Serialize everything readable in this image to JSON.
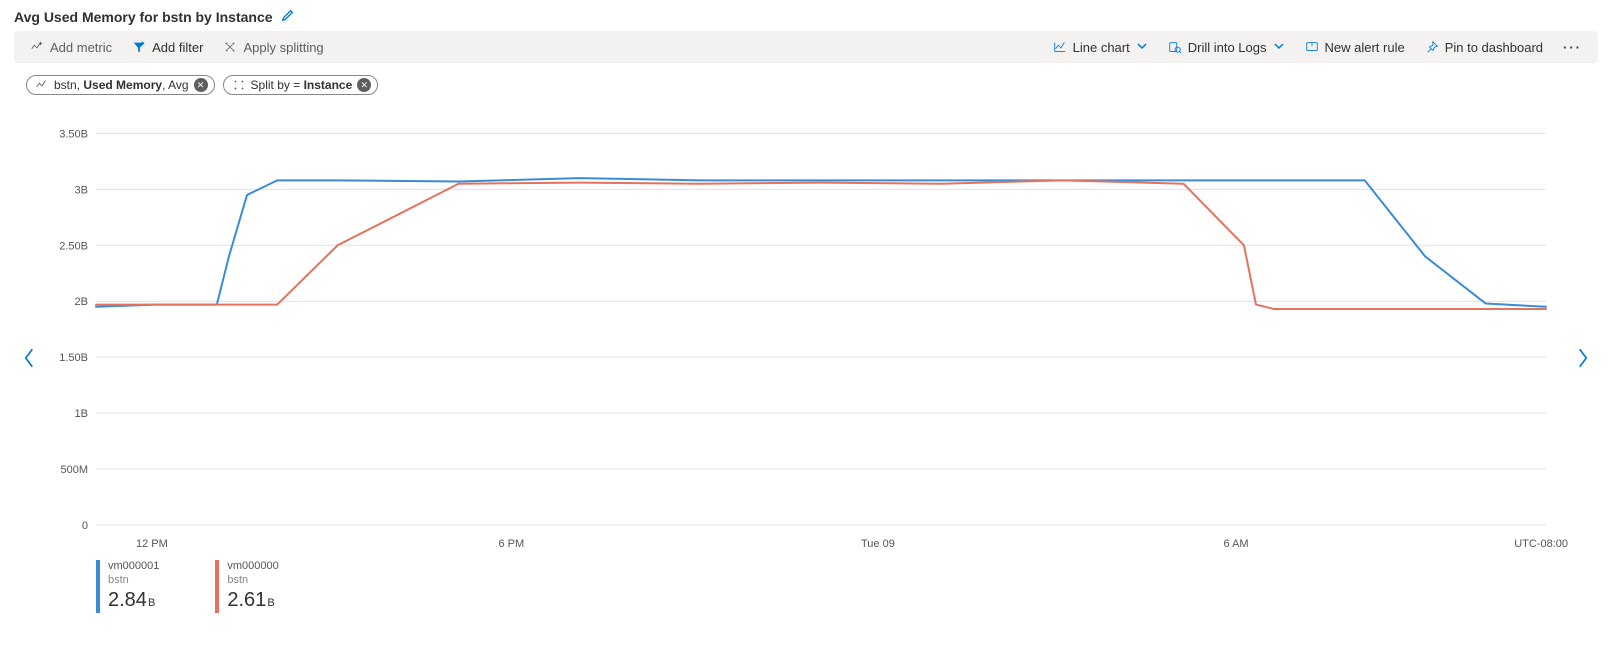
{
  "header": {
    "title": "Avg Used Memory for bstn by Instance"
  },
  "toolbar": {
    "add_metric": "Add metric",
    "add_filter": "Add filter",
    "apply_splitting": "Apply splitting",
    "line_chart": "Line chart",
    "drill_logs": "Drill into Logs",
    "new_alert": "New alert rule",
    "pin_dash": "Pin to dashboard"
  },
  "chips": {
    "metric_pre": "bstn, ",
    "metric_bold": "Used Memory",
    "metric_post": ", Avg",
    "split_pre": "Split by = ",
    "split_bold": "Instance"
  },
  "legend": [
    {
      "name": "vm000001",
      "source": "bstn",
      "value": "2.84",
      "unit": "B",
      "color": "#3b8bd8"
    },
    {
      "name": "vm000000",
      "source": "bstn",
      "value": "2.61",
      "unit": "B",
      "color": "#e3735e"
    }
  ],
  "axis": {
    "y_ticks": [
      "3.50B",
      "3B",
      "2.50B",
      "2B",
      "1.50B",
      "1B",
      "500M",
      "0"
    ],
    "x_ticks": [
      "12 PM",
      "6 PM",
      "Tue 09",
      "6 AM"
    ],
    "timezone": "UTC-08:00"
  },
  "chart_data": {
    "type": "line",
    "title": "Avg Used Memory for bstn by Instance",
    "xlabel": "",
    "ylabel": "",
    "ylim": [
      0,
      3.7
    ],
    "y_unit": "B",
    "y_ticks": [
      0,
      0.5,
      1,
      1.5,
      2,
      2.5,
      3,
      3.5
    ],
    "x_scale_hours_from_noon": true,
    "x": [
      0,
      1,
      2,
      2.2,
      2.5,
      3,
      4,
      6,
      8,
      10,
      12,
      14,
      16,
      18,
      19,
      19.2,
      19.5,
      20,
      21,
      22,
      23,
      24
    ],
    "series": [
      {
        "name": "vm000001",
        "color": "#3b8bd8",
        "values": [
          1.95,
          1.97,
          1.97,
          2.4,
          2.95,
          3.08,
          3.08,
          3.07,
          3.1,
          3.08,
          3.08,
          3.08,
          3.08,
          3.08,
          3.08,
          3.08,
          3.08,
          3.08,
          3.08,
          2.4,
          1.98,
          1.95
        ]
      },
      {
        "name": "vm000000",
        "color": "#e3735e",
        "values": [
          1.97,
          1.97,
          1.97,
          1.97,
          1.97,
          1.97,
          2.5,
          3.05,
          3.06,
          3.05,
          3.06,
          3.05,
          3.08,
          3.05,
          2.5,
          1.97,
          1.93,
          1.93,
          1.93,
          1.93,
          1.93,
          1.93
        ]
      }
    ],
    "x_ticks_labels": [
      {
        "x": 0,
        "label": "12 PM"
      },
      {
        "x": 6,
        "label": "6 PM"
      },
      {
        "x": 12,
        "label": "Tue 09"
      },
      {
        "x": 18,
        "label": "6 AM"
      }
    ],
    "x_range": [
      0,
      24
    ]
  }
}
